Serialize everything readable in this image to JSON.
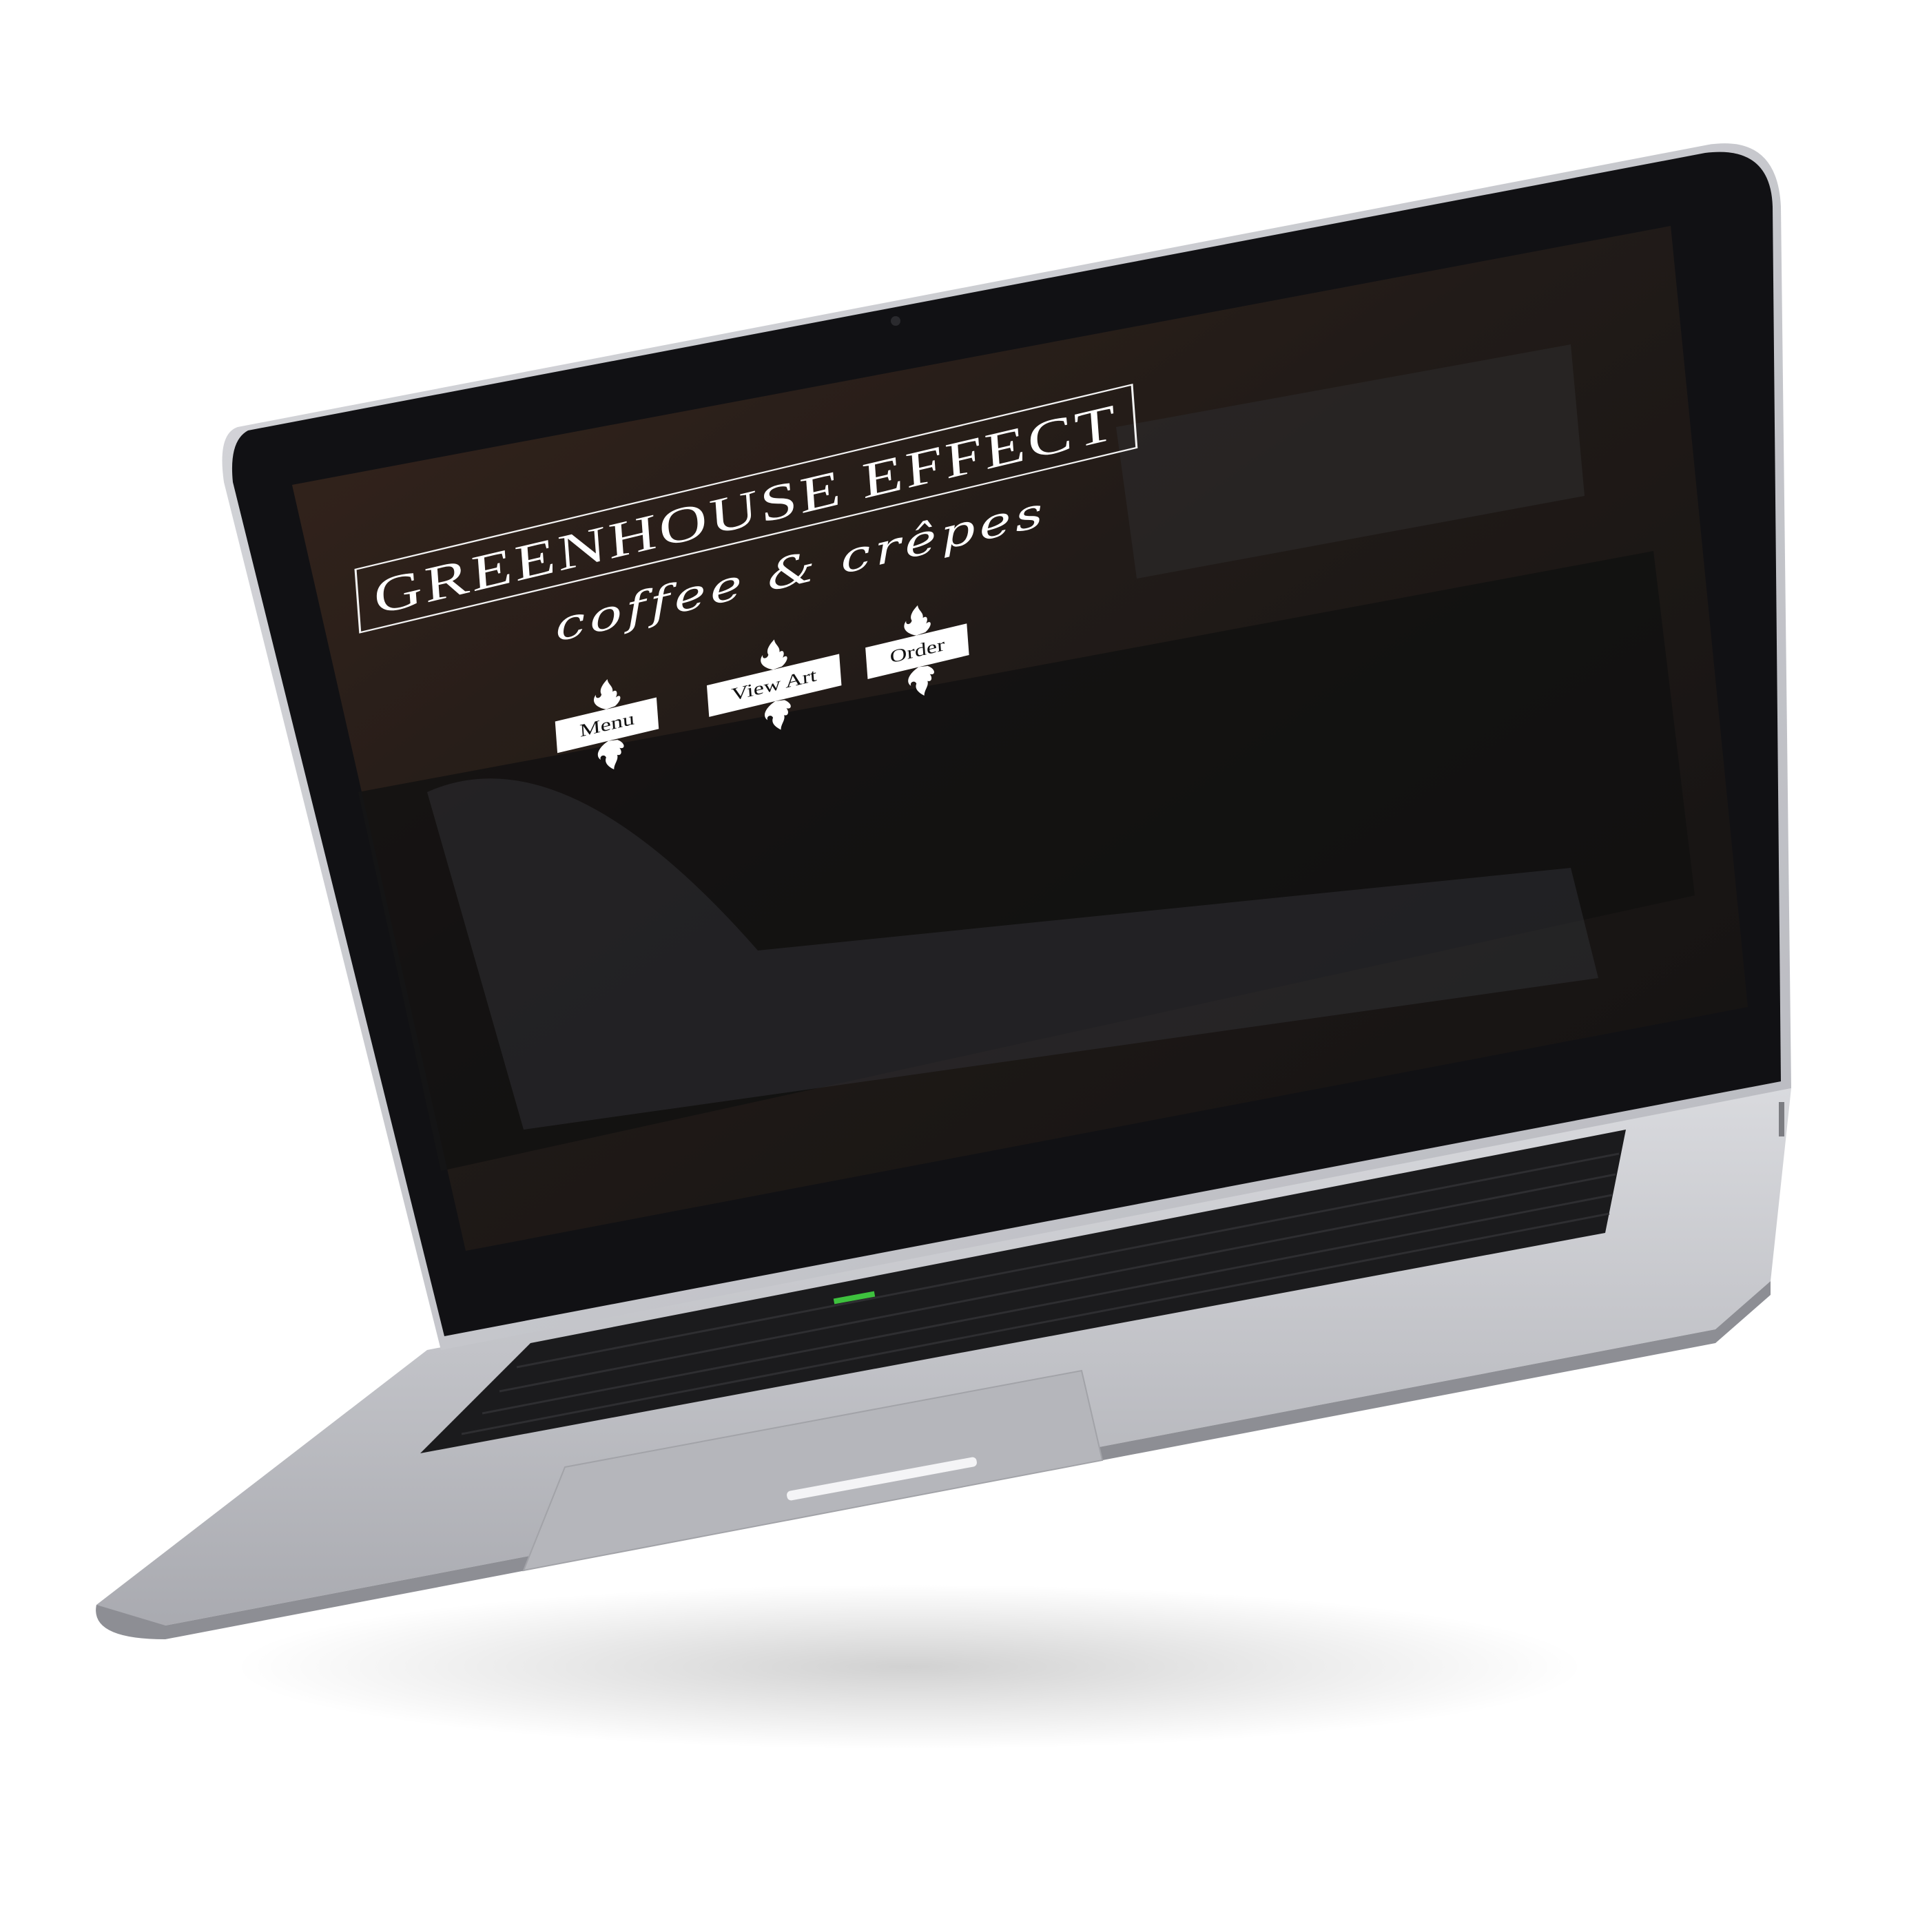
{
  "site": {
    "title": "GREENHOUSE EFFECT",
    "tagline": "coffee & crêpes"
  },
  "nav": {
    "buttons": [
      {
        "label": "Menu"
      },
      {
        "label": "View Art"
      },
      {
        "label": "Order"
      }
    ]
  },
  "colors": {
    "screen_bezel": "#111114",
    "hero_overlay": "#2a1f1a",
    "laptop_body": "#c5c6cb",
    "keyboard": "#1b1b1d",
    "button_bg": "#ffffff"
  },
  "device": {
    "type": "laptop",
    "indicator_light": "green"
  }
}
